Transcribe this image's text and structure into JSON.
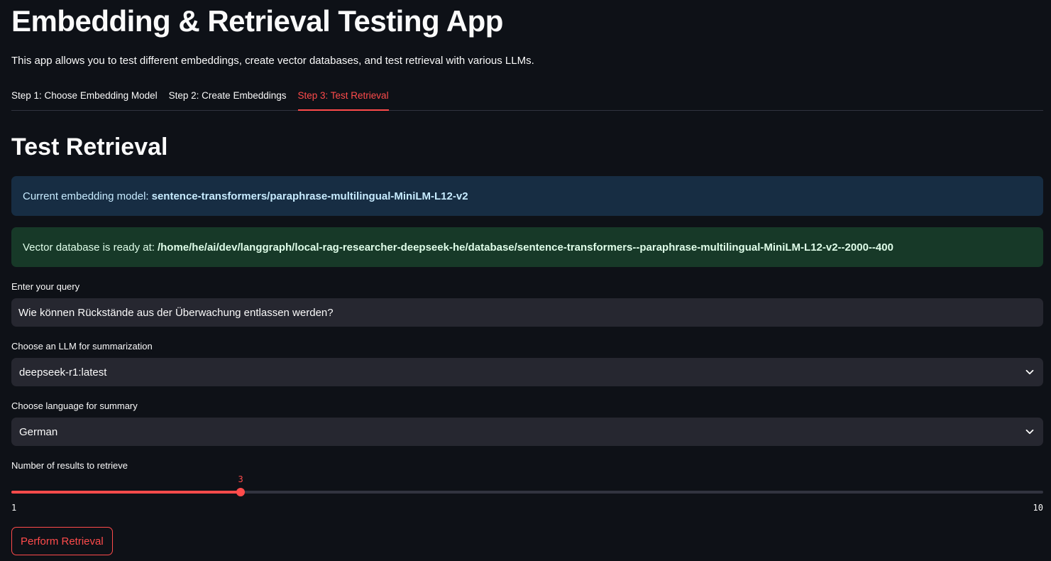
{
  "header": {
    "title": "Embedding & Retrieval Testing App",
    "description": "This app allows you to test different embeddings, create vector databases, and test retrieval with various LLMs."
  },
  "tabs": [
    {
      "label": "Step 1: Choose Embedding Model",
      "active": false
    },
    {
      "label": "Step 2: Create Embeddings",
      "active": false
    },
    {
      "label": "Step 3: Test Retrieval",
      "active": true
    }
  ],
  "section": {
    "title": "Test Retrieval"
  },
  "alerts": {
    "model_prefix": "Current embedding model:",
    "model_value": "sentence-transformers/paraphrase-multilingual-MiniLM-L12-v2",
    "db_prefix": "Vector database is ready at:",
    "db_value": "/home/he/ai/dev/langgraph/local-rag-researcher-deepseek-he/database/sentence-transformers--paraphrase-multilingual-MiniLM-L12-v2--2000--400"
  },
  "query": {
    "label": "Enter your query",
    "value": "Wie können Rückstände aus der Überwachung entlassen werden?"
  },
  "llm_select": {
    "label": "Choose an LLM for summarization",
    "value": "deepseek-r1:latest"
  },
  "language_select": {
    "label": "Choose language for summary",
    "value": "German"
  },
  "results_slider": {
    "label": "Number of results to retrieve",
    "value": "3",
    "min": "1",
    "max": "10"
  },
  "actions": {
    "retrieve_label": "Perform Retrieval"
  },
  "colors": {
    "background": "#0e1117",
    "accent": "#ff4b4b",
    "info_bg": "#172d43",
    "success_bg": "#173928",
    "input_bg": "#262730"
  },
  "icons": {
    "select_chevron": "chevron-down-icon"
  }
}
